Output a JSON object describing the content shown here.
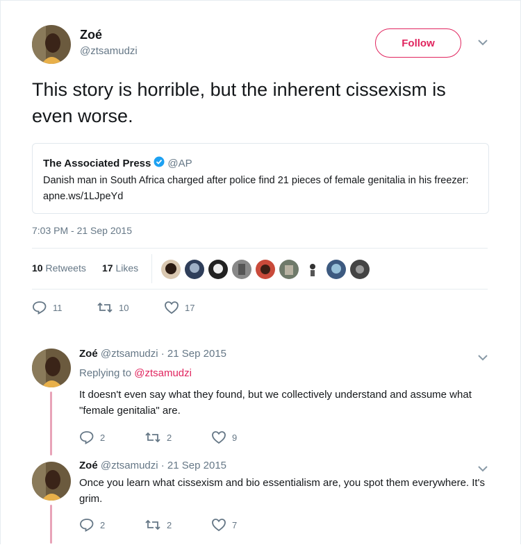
{
  "main_tweet": {
    "author_name": "Zoé",
    "author_handle": "@ztsamudzi",
    "follow_label": "Follow",
    "text": "This story is horrible, but the inherent cissexism is even worse.",
    "timestamp": "7:03 PM - 21 Sep 2015",
    "retweets_count": "10",
    "retweets_label": "Retweets",
    "likes_count": "17",
    "likes_label": "Likes",
    "actions": {
      "replies": "11",
      "retweets": "10",
      "likes": "17"
    }
  },
  "quoted_tweet": {
    "author_name": "The Associated Press",
    "author_handle": "@AP",
    "text": "Danish man in South Africa charged after police find 21 pieces of female genitalia in his freezer: apne.ws/1LJpeYd"
  },
  "replies": [
    {
      "author_name": "Zoé",
      "meta": "@ztsamudzi · 21 Sep 2015",
      "replying_prefix": "Replying to",
      "replying_handle": "@ztsamudzi",
      "text": "It doesn't even say what they found, but we collectively understand and assume what \"female genitalia\" are.",
      "actions": {
        "replies": "2",
        "retweets": "2",
        "likes": "9"
      }
    },
    {
      "author_name": "Zoé",
      "meta": "@ztsamudzi · 21 Sep 2015",
      "text": "Once you learn what cissexism and bio essentialism are, you spot them everywhere. It's grim.",
      "actions": {
        "replies": "2",
        "retweets": "2",
        "likes": "7"
      }
    }
  ],
  "colors": {
    "accent": "#e0245e",
    "verified": "#1da1f2",
    "thread_line": "#e8a3b8",
    "muted_text": "#657786"
  }
}
